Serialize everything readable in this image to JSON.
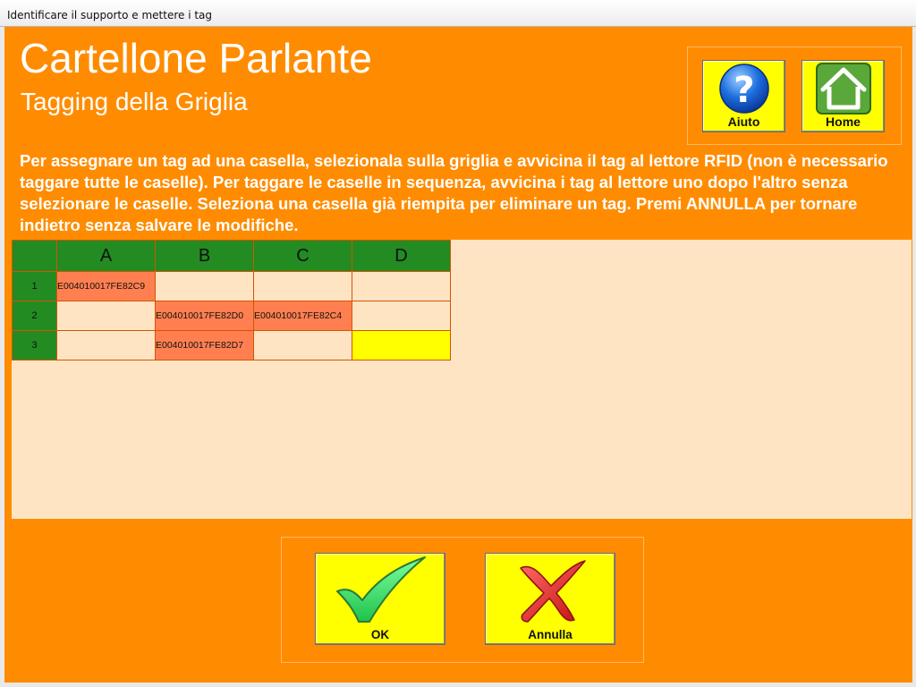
{
  "window": {
    "title": "Identificare il supporto e mettere i tag"
  },
  "header": {
    "title": "Cartellone Parlante",
    "subtitle": "Tagging della Griglia"
  },
  "instructions": "Per assegnare un tag ad una casella, selezionala sulla griglia e avvicina il tag al lettore RFID (non è necessario taggare tutte le caselle). Per taggare le caselle in sequenza, avvicina i tag al lettore uno dopo l'altro senza selezionare le caselle. Seleziona una casella già riempita per eliminare un tag. Premi ANNULLA per tornare indietro senza salvare le modifiche.",
  "toolbar": {
    "help_label": "Aiuto",
    "home_label": "Home",
    "help_icon": "help-icon",
    "home_icon": "home-icon"
  },
  "grid": {
    "columns": [
      "A",
      "B",
      "C",
      "D"
    ],
    "rows": [
      {
        "label": "1",
        "cells": [
          "E004010017FE82C9",
          "",
          "",
          ""
        ],
        "states": [
          "tagged",
          "empty",
          "empty",
          "empty"
        ]
      },
      {
        "label": "2",
        "cells": [
          "",
          "E004010017FE82D0",
          "E004010017FE82C4",
          ""
        ],
        "states": [
          "empty",
          "tagged",
          "tagged",
          "empty"
        ]
      },
      {
        "label": "3",
        "cells": [
          "",
          "E004010017FE82D7",
          "",
          ""
        ],
        "states": [
          "empty",
          "tagged",
          "empty",
          "selected"
        ]
      }
    ]
  },
  "actions": {
    "ok_label": "OK",
    "cancel_label": "Annulla",
    "ok_icon": "checkmark-icon",
    "cancel_icon": "cross-icon"
  },
  "colors": {
    "background": "#ff8c00",
    "button": "#ffff00",
    "header_cell": "#228b22",
    "tagged_cell": "#ff7f50",
    "empty_cell": "#ffe4c4",
    "selected_cell": "#ffff00"
  }
}
